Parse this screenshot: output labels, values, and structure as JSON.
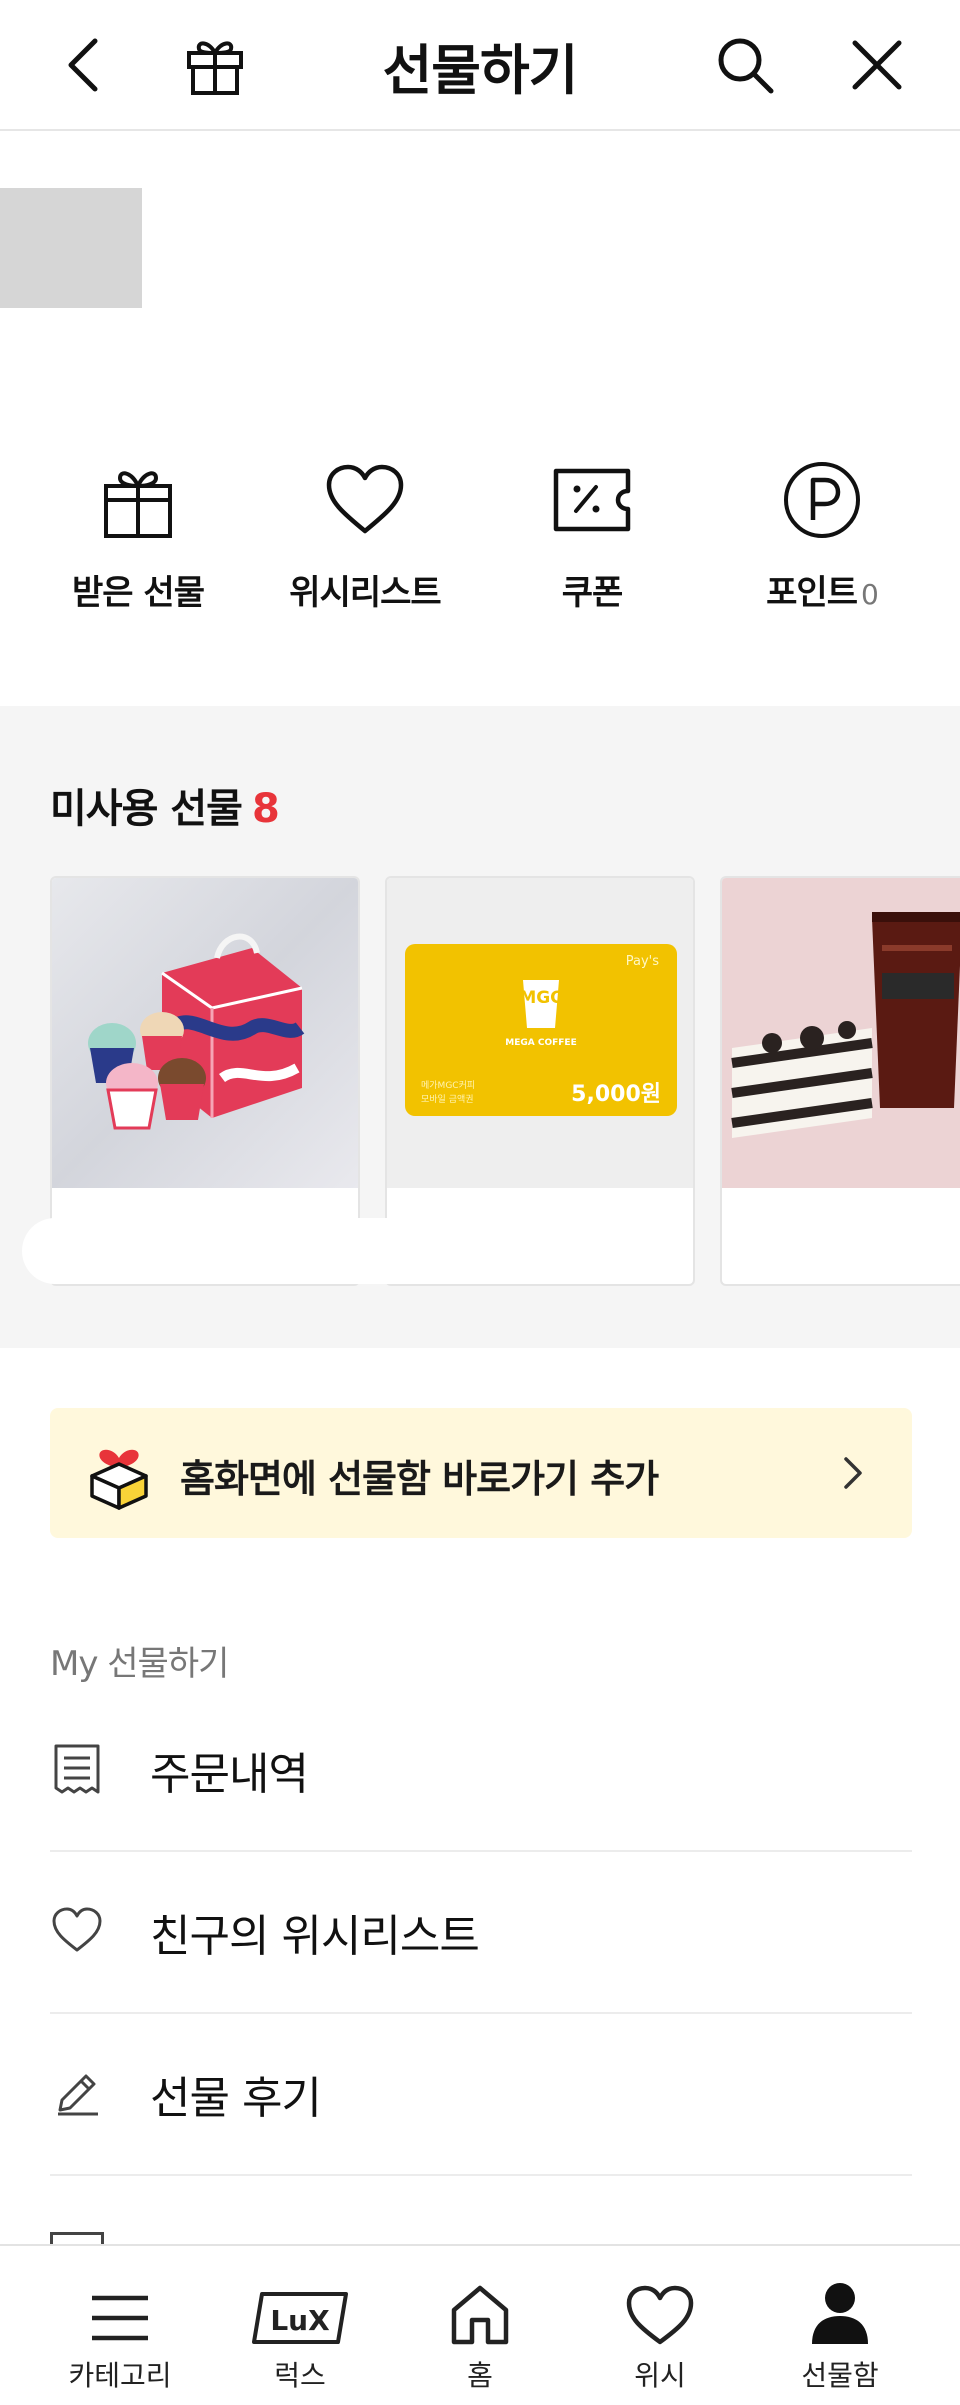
{
  "header": {
    "title": "선물하기",
    "icons": [
      "back-icon",
      "gift-icon",
      "search-icon",
      "close-icon"
    ]
  },
  "quick_menu": {
    "items": [
      {
        "label": "받은 선물",
        "icon": "gift-box-icon"
      },
      {
        "label": "위시리스트",
        "icon": "heart-icon"
      },
      {
        "label": "쿠폰",
        "icon": "coupon-icon"
      },
      {
        "label": "포인트",
        "icon": "point-icon",
        "count": "0"
      }
    ]
  },
  "unused_gifts": {
    "title": "미사용 선물",
    "count": "8",
    "cards": [
      {
        "icon": "ice-cream-image"
      },
      {
        "icon": "gift-card-image",
        "brand": "MGC",
        "brand_sub": "MEGA COFFEE",
        "badge": "Pay's",
        "amount": "5,000원",
        "line1": "메가MGC커피",
        "line2": "모바일 금액권"
      },
      {
        "icon": "cake-coffee-image"
      }
    ]
  },
  "banner": {
    "text": "홈화면에 선물함 바로가기 추가"
  },
  "my_section": {
    "title": "My 선물하기",
    "items": [
      {
        "label": "주문내역",
        "icon": "receipt-icon"
      },
      {
        "label": "친구의 위시리스트",
        "icon": "heart-outline-icon"
      },
      {
        "label": "선물 후기",
        "icon": "pencil-icon"
      }
    ]
  },
  "bottom_nav": {
    "items": [
      {
        "label": "카테고리",
        "icon": "menu-icon"
      },
      {
        "label": "럭스",
        "icon": "lux-icon",
        "badge": "LuX"
      },
      {
        "label": "홈",
        "icon": "home-icon"
      },
      {
        "label": "위시",
        "icon": "heart-nav-icon"
      },
      {
        "label": "선물함",
        "icon": "person-icon"
      }
    ]
  },
  "colors": {
    "accent_red": "#e8343a",
    "banner_bg": "#fff8dc",
    "section_bg": "#f5f5f5",
    "card_yellow": "#f2c200"
  }
}
